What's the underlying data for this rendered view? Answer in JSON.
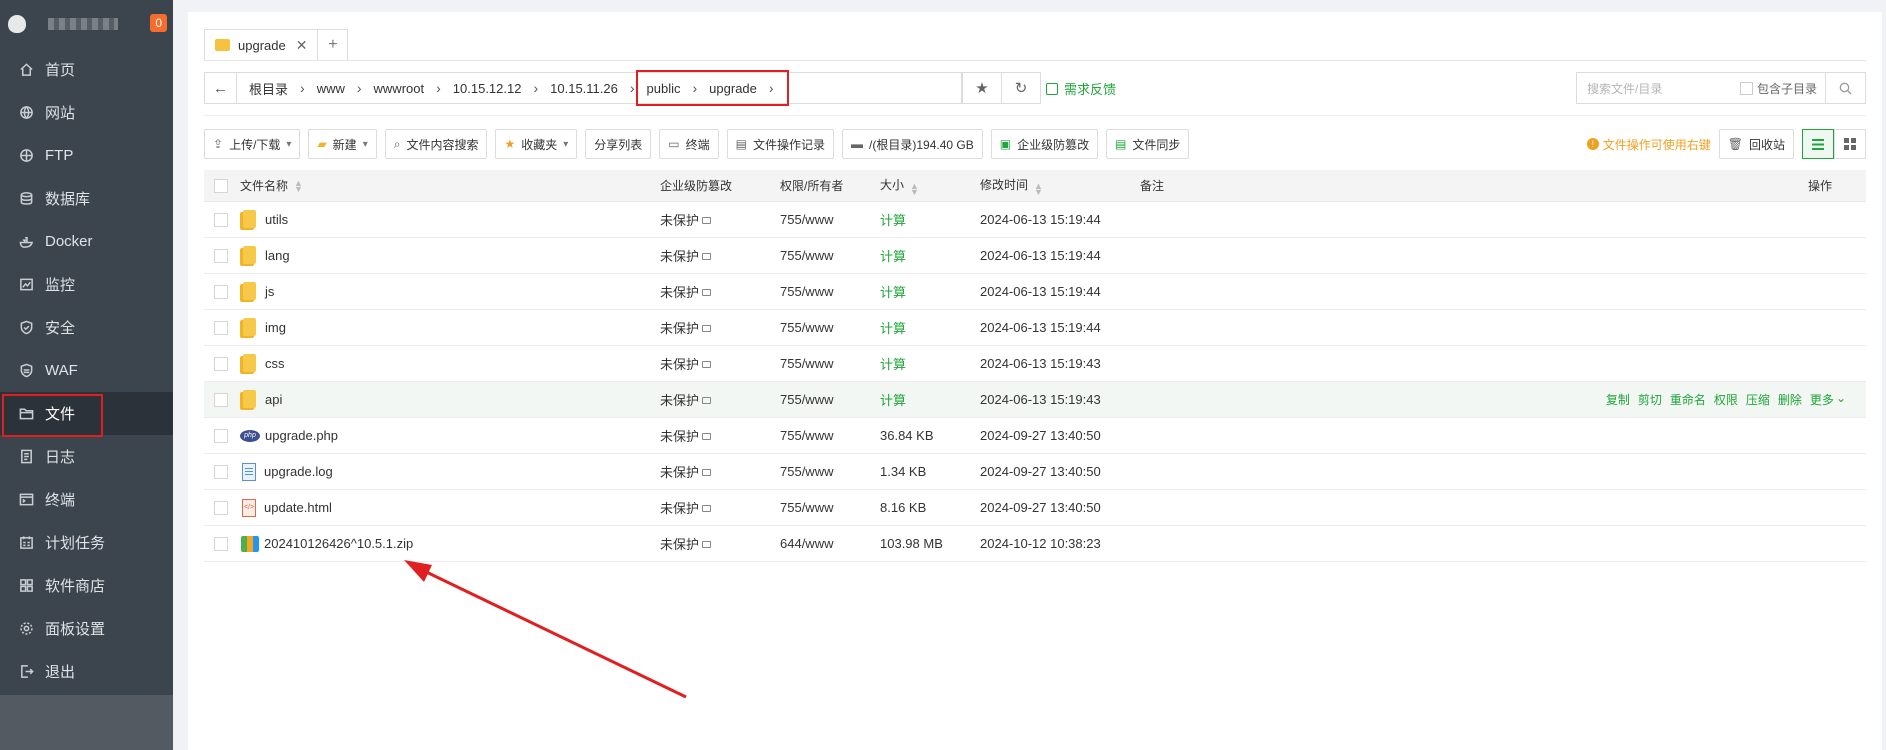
{
  "sidebar": {
    "badge": "0",
    "items": [
      {
        "label": "首页",
        "icon": "home-icon"
      },
      {
        "label": "网站",
        "icon": "globe-icon"
      },
      {
        "label": "FTP",
        "icon": "ftp-icon"
      },
      {
        "label": "数据库",
        "icon": "database-icon"
      },
      {
        "label": "Docker",
        "icon": "docker-icon"
      },
      {
        "label": "监控",
        "icon": "monitor-icon"
      },
      {
        "label": "安全",
        "icon": "shield-icon"
      },
      {
        "label": "WAF",
        "icon": "waf-icon"
      },
      {
        "label": "文件",
        "icon": "folder-icon"
      },
      {
        "label": "日志",
        "icon": "log-icon"
      },
      {
        "label": "终端",
        "icon": "terminal-icon"
      },
      {
        "label": "计划任务",
        "icon": "cron-icon"
      },
      {
        "label": "软件商店",
        "icon": "store-icon"
      },
      {
        "label": "面板设置",
        "icon": "gear-icon"
      },
      {
        "label": "退出",
        "icon": "logout-icon"
      }
    ]
  },
  "tabs": {
    "current": "upgrade",
    "add": "+"
  },
  "path": {
    "crumbs": [
      "根目录",
      "www",
      "wwwroot",
      "10.15.12.12",
      "10.15.11.26",
      "public",
      "upgrade"
    ],
    "feedback": "需求反馈"
  },
  "search": {
    "placeholder": "搜索文件/目录",
    "include_sub": "包含子目录"
  },
  "toolbar": {
    "upload": "上传/下载",
    "new": "新建",
    "content_search": "文件内容搜索",
    "favorites": "收藏夹",
    "share_list": "分享列表",
    "terminal": "终端",
    "op_log": "文件操作记录",
    "disk": "/(根目录)194.40 GB",
    "tamper": "企业级防篡改",
    "sync": "文件同步",
    "hint": "文件操作可使用右键",
    "recycle": "回收站"
  },
  "table": {
    "headers": {
      "name": "文件名称",
      "protect": "企业级防篡改",
      "perm": "权限/所有者",
      "size": "大小",
      "mtime": "修改时间",
      "note": "备注",
      "ops": "操作"
    },
    "rows": [
      {
        "name": "utils",
        "type": "folder",
        "protect": "未保护",
        "perm": "755/www",
        "size": "计算",
        "mtime": "2024-06-13 15:19:44"
      },
      {
        "name": "lang",
        "type": "folder",
        "protect": "未保护",
        "perm": "755/www",
        "size": "计算",
        "mtime": "2024-06-13 15:19:44"
      },
      {
        "name": "js",
        "type": "folder",
        "protect": "未保护",
        "perm": "755/www",
        "size": "计算",
        "mtime": "2024-06-13 15:19:44"
      },
      {
        "name": "img",
        "type": "folder",
        "protect": "未保护",
        "perm": "755/www",
        "size": "计算",
        "mtime": "2024-06-13 15:19:44"
      },
      {
        "name": "css",
        "type": "folder",
        "protect": "未保护",
        "perm": "755/www",
        "size": "计算",
        "mtime": "2024-06-13 15:19:43"
      },
      {
        "name": "api",
        "type": "folder",
        "protect": "未保护",
        "perm": "755/www",
        "size": "计算",
        "mtime": "2024-06-13 15:19:43"
      },
      {
        "name": "upgrade.php",
        "type": "php",
        "protect": "未保护",
        "perm": "755/www",
        "size": "36.84 KB",
        "mtime": "2024-09-27 13:40:50"
      },
      {
        "name": "upgrade.log",
        "type": "log",
        "protect": "未保护",
        "perm": "755/www",
        "size": "1.34 KB",
        "mtime": "2024-09-27 13:40:50"
      },
      {
        "name": "update.html",
        "type": "html",
        "protect": "未保护",
        "perm": "755/www",
        "size": "8.16 KB",
        "mtime": "2024-09-27 13:40:50"
      },
      {
        "name": "202410126426^10.5.1.zip",
        "type": "zip",
        "protect": "未保护",
        "perm": "644/www",
        "size": "103.98 MB",
        "mtime": "2024-10-12 10:38:23"
      }
    ],
    "row_ops": [
      "复制",
      "剪切",
      "重命名",
      "权限",
      "压缩",
      "删除",
      "更多"
    ]
  },
  "colors": {
    "accent": "#20a53a",
    "highlight": "#e02020",
    "sidebar": "#3c444d"
  }
}
